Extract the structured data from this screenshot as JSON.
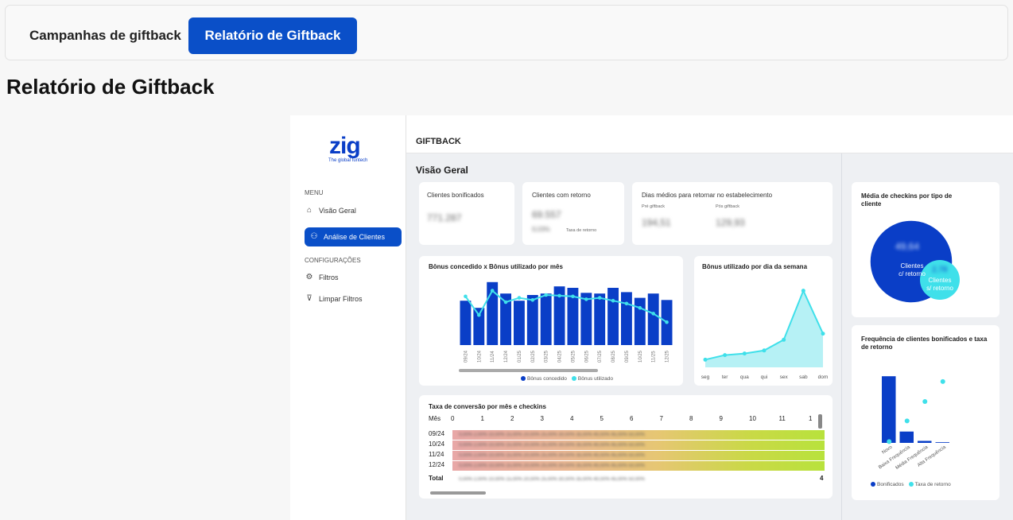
{
  "tabs": [
    {
      "label": "Campanhas de giftback",
      "active": false
    },
    {
      "label": "Relatório de Giftback",
      "active": true
    }
  ],
  "page_title": "Relatório de Giftback",
  "colors": {
    "accent": "#0a4fc8",
    "cyan": "#3fe0ea",
    "navy": "#0a3ec7"
  },
  "report": {
    "logo": "zig",
    "logo_sub": "The global funtech",
    "menu_label": "MENU",
    "menu": [
      {
        "label": "Visão Geral",
        "icon": "home-icon",
        "active": false
      },
      {
        "label": "Análise de Clientes",
        "icon": "clients-icon",
        "active": true
      }
    ],
    "config_label": "CONFIGURAÇÕES",
    "config": [
      {
        "label": "Filtros",
        "icon": "gear-icon"
      },
      {
        "label": "Limpar Filtros",
        "icon": "clear-filter-icon"
      }
    ],
    "header_title": "GIFTBACK",
    "section_title": "Visão Geral",
    "kpis": {
      "clientes_bonificados": {
        "label": "Clientes bonificados",
        "value": "771.287"
      },
      "clientes_retorno": {
        "label": "Clientes com retorno",
        "value": "69.557",
        "sub_value": "9,03%",
        "sub_label": "Taxa de retorno"
      },
      "dias_medios": {
        "label": "Dias médios para retornar no estabelecimento",
        "pre_label": "Pré giftback",
        "pre_value": "194,51",
        "pos_label": "Pós giftback",
        "pos_value": "129,93"
      }
    },
    "checkins_card": {
      "title": "Média de checkins por tipo de cliente",
      "big_value": "49,64",
      "big_label_1": "Clientes",
      "big_label_2": "c/ retorno",
      "small_value": "2,78",
      "small_label_1": "Clientes",
      "small_label_2": "s/ retorno"
    },
    "freq_card": {
      "title": "Frequência de clientes bonificados e taxa de retorno"
    },
    "heatmap": {
      "title": "Taxa de conversão por mês e checkins",
      "header_label": "Mês",
      "columns": [
        "0",
        "1",
        "2",
        "3",
        "4",
        "5",
        "6",
        "7",
        "8",
        "9",
        "10",
        "11",
        "1"
      ],
      "rows": [
        "09/24",
        "10/24",
        "11/24",
        "12/24"
      ],
      "total_label": "Total",
      "total_last": "4",
      "blur_text": "0,00%  2,00%  10,00%  15,00%  20,00%  25,00%  30,00%  35,00%  40,00%  45,00%  50,00%"
    }
  },
  "chart_data": [
    {
      "type": "bar",
      "title": "Bônus concedido x Bônus utilizado por mês",
      "categories": [
        "09/24",
        "10/24",
        "11/24",
        "12/24",
        "01/25",
        "02/25",
        "03/25",
        "04/25",
        "05/25",
        "06/25",
        "07/25",
        "08/25",
        "09/25",
        "10/25",
        "11/25",
        "12/25"
      ],
      "series": [
        {
          "name": "Bônus concedido",
          "values": [
            62,
            52,
            88,
            72,
            62,
            70,
            72,
            82,
            80,
            73,
            72,
            80,
            74,
            66,
            72,
            63
          ]
        },
        {
          "name": "Bônus utilizado",
          "values": [
            68,
            42,
            76,
            60,
            66,
            63,
            70,
            69,
            68,
            64,
            66,
            62,
            58,
            52,
            44,
            32
          ]
        }
      ],
      "ylim": [
        0,
        100
      ],
      "legend": "bottom"
    },
    {
      "type": "area",
      "title": "Bônus utilizado por dia da semana",
      "categories": [
        "seg",
        "ter",
        "qua",
        "qui",
        "sex",
        "sab",
        "dom"
      ],
      "values": [
        10,
        16,
        18,
        22,
        36,
        100,
        44
      ],
      "ylim": [
        0,
        110
      ]
    },
    {
      "type": "bar",
      "title": "Frequência de clientes bonificados e taxa de retorno",
      "categories": [
        "Novo",
        "Baixa Frequência",
        "Média Frequência",
        "Alta Frequência"
      ],
      "series": [
        {
          "name": "Bonificados",
          "values": [
            100,
            17,
            3,
            1
          ]
        },
        {
          "name": "Taxa de retorno",
          "values": [
            2,
            33,
            62,
            92
          ]
        }
      ],
      "ylim": [
        0,
        105
      ],
      "legend": "bottom"
    }
  ]
}
